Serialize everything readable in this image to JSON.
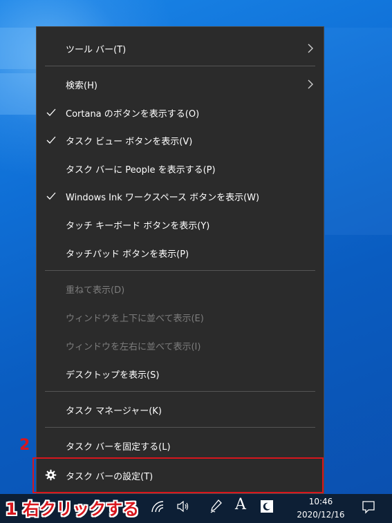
{
  "menu": {
    "items": [
      {
        "label": "ツール バー(T)",
        "submenu": true
      },
      {
        "label": "検索(H)",
        "submenu": true
      },
      {
        "label": "Cortana のボタンを表示する(O)",
        "checked": true
      },
      {
        "label": "タスク ビュー ボタンを表示(V)",
        "checked": true
      },
      {
        "label": "タスク バーに People を表示する(P)"
      },
      {
        "label": "Windows Ink ワークスペース ボタンを表示(W)",
        "checked": true
      },
      {
        "label": "タッチ キーボード ボタンを表示(Y)"
      },
      {
        "label": "タッチパッド ボタンを表示(P)"
      },
      {
        "label": "重ねて表示(D)",
        "disabled": true
      },
      {
        "label": "ウィンドウを上下に並べて表示(E)",
        "disabled": true
      },
      {
        "label": "ウィンドウを左右に並べて表示(I)",
        "disabled": true
      },
      {
        "label": "デスクトップを表示(S)"
      },
      {
        "label": "タスク マネージャー(K)"
      },
      {
        "label": "タスク バーを固定する(L)"
      },
      {
        "label": "タスク バーの設定(T)",
        "icon": "gear-icon"
      }
    ]
  },
  "annotations": {
    "step1": "1 右クリックする",
    "step2": "2"
  },
  "taskbar": {
    "time": "10:46",
    "date": "2020/12/16",
    "ime_label": "A",
    "icons": [
      "wifi-icon",
      "volume-icon",
      "pen-icon",
      "ime-icon",
      "moon-app-icon",
      "notification-icon"
    ]
  },
  "colors": {
    "menu_bg": "#2b2b2b",
    "menu_text": "#ffffff",
    "disabled_text": "#7d7d7d",
    "annotation": "#d8161d",
    "taskbar_bg": "#0d1f35"
  }
}
